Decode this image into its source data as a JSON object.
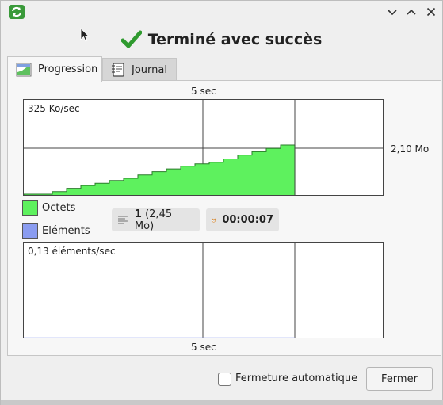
{
  "window": {
    "status_text": "Terminé avec succès"
  },
  "tabs": [
    {
      "label": "Progression",
      "icon": "progress-chart-icon",
      "active": true
    },
    {
      "label": "Journal",
      "icon": "notebook-icon",
      "active": false
    }
  ],
  "bytes_chart": {
    "top_caption": "5 sec",
    "rate_label": "325 Ko/sec",
    "side_label": "2,10 Mo",
    "fill_color": "#5ef15e"
  },
  "legend": {
    "bytes_label": "Octets",
    "bytes_color": "#5ef15e",
    "items_label": "Eléments",
    "items_color": "#8a9cf0"
  },
  "summary": {
    "count": "1",
    "size": "(2,45 Mo)",
    "elapsed": "00:00:07"
  },
  "items_chart": {
    "rate_label": "0,13 éléments/sec",
    "bottom_caption": "5 sec"
  },
  "footer": {
    "auto_close_label": "Fermeture automatique",
    "auto_close_checked": false,
    "close_label": "Fermer"
  },
  "chart_data": {
    "type": "area",
    "steps": [
      0.0,
      0.0,
      0.06,
      0.12,
      0.17,
      0.21,
      0.26,
      0.3,
      0.36,
      0.42,
      0.47,
      0.52,
      0.56,
      0.59,
      0.65,
      0.72,
      0.78,
      0.84,
      0.9
    ],
    "ylabel": "325 Ko/sec"
  }
}
